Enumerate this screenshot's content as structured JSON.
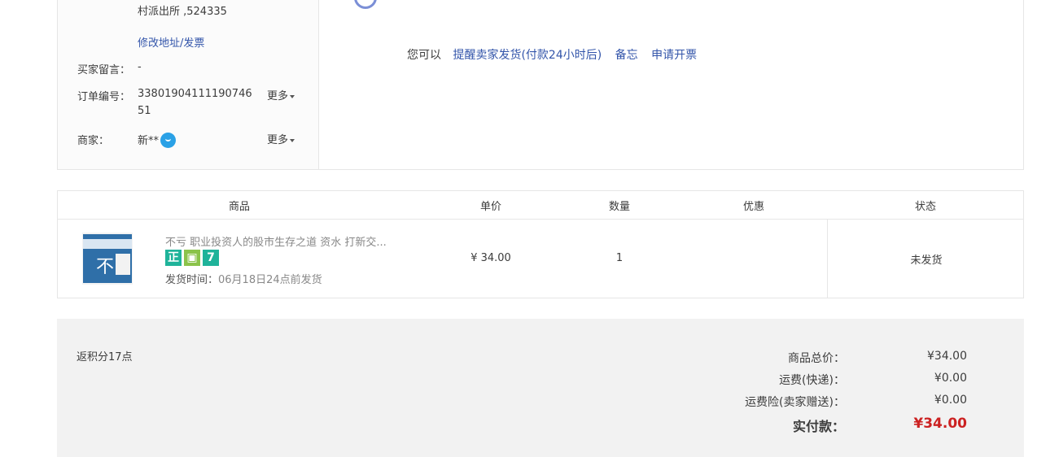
{
  "order_info": {
    "address_tail": "村派出所 ,524335",
    "modify_link": "修改地址/发票",
    "buyer_message_label": "买家留言：",
    "buyer_message_value": "-",
    "order_no_label": "订单编号：",
    "order_no_value": "3380190411119074651",
    "seller_label": "商家：",
    "seller_value": "新**",
    "more_label": "更多"
  },
  "actions": {
    "intro": "您可以",
    "remind": "提醒卖家发货(付款24小时后)",
    "memo": "备忘",
    "invoice": "申请开票"
  },
  "table": {
    "headers": {
      "product": "商品",
      "price": "单价",
      "qty": "数量",
      "discount": "优惠",
      "status": "状态"
    },
    "item": {
      "title": "不亏 职业投资人的股市生存之道 资水 打新交...",
      "badges": [
        "正",
        "",
        "7"
      ],
      "ship_time_label": "发货时间：",
      "ship_time_value": "06月18日24点前发货",
      "price": "¥ 34.00",
      "qty": "1",
      "status": "未发货"
    }
  },
  "summary": {
    "points": "返积分17点",
    "goods_total_label": "商品总价：",
    "goods_total_value": "¥34.00",
    "shipping_label": "运费(快递)：",
    "shipping_value": "¥0.00",
    "insurance_label": "运费险(卖家赠送)：",
    "insurance_value": "¥0.00",
    "paid_label": "实付款：",
    "paid_value": "¥34.00"
  },
  "colors": {
    "link": "#3355aa",
    "price_red": "#cc2222",
    "badge_green": "#1fb39a"
  }
}
